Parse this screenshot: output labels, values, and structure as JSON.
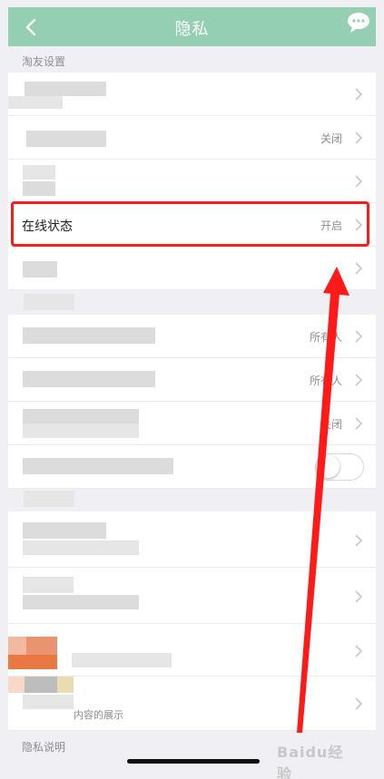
{
  "header": {
    "title": "隐私",
    "back_icon": "chevron-left-icon",
    "chat_icon": "chat-bubble-icon"
  },
  "sections": {
    "friends_label": "淘友设置",
    "privacy_info_label": "隐私说明"
  },
  "rows": {
    "row2_value": "关闭",
    "online_status": {
      "label": "在线状态",
      "value": "开启"
    },
    "row6_value": "所有人",
    "row7_value": "所有人",
    "row8_value": "关闭",
    "row12_partial": "内容的展示"
  },
  "watermark": {
    "text": "Baidu经验"
  },
  "colors": {
    "header_bg": "#95cfb1",
    "highlight": "#ff1a1a",
    "background": "#efeff4"
  }
}
